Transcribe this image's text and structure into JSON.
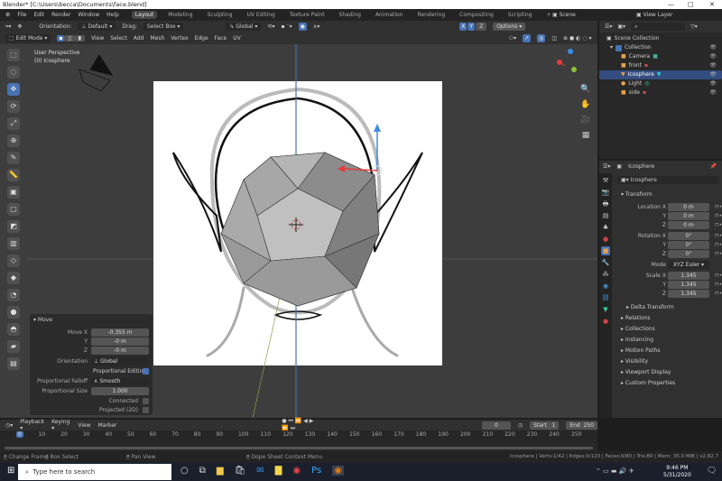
{
  "window": {
    "title": "Blender* [C:\\Users\\becca\\Documents\\face.blend]",
    "min": "—",
    "max": "□",
    "close": "✕"
  },
  "menu": [
    "File",
    "Edit",
    "Render",
    "Window",
    "Help"
  ],
  "workspaces": [
    "Layout",
    "Modeling",
    "Sculpting",
    "UV Editing",
    "Texture Paint",
    "Shading",
    "Animation",
    "Rendering",
    "Compositing",
    "Scripting",
    "+"
  ],
  "scene": "Scene",
  "view_layer": "View Layer",
  "header": {
    "orientation_label": "Orientation:",
    "orientation": "Default",
    "drag_label": "Drag:",
    "drag": "Select Box",
    "transform_orientation": "Global",
    "axes": [
      "X",
      "Y",
      "Z"
    ],
    "options": "Options"
  },
  "header2": {
    "mode": "Edit Mode",
    "menus": [
      "View",
      "Select",
      "Add",
      "Mesh",
      "Vertex",
      "Edge",
      "Face",
      "UV"
    ]
  },
  "viewport": {
    "perspective": "User Perspective",
    "object": "(0) Icosphere"
  },
  "outliner": {
    "root": "Scene Collection",
    "collection": "Collection",
    "items": [
      {
        "name": "Camera",
        "color": "#e8a050"
      },
      {
        "name": "front",
        "color": "#e8a050"
      },
      {
        "name": "Icosphere",
        "color": "#e8a050"
      },
      {
        "name": "Light",
        "color": "#e8a050"
      },
      {
        "name": "side",
        "color": "#e8a050"
      }
    ]
  },
  "properties": {
    "object": "Icosphere",
    "name_field": "Icosphere",
    "section": "Transform",
    "location": {
      "label": "Location X",
      "x": "0 m",
      "y": "0 m",
      "z": "0 m"
    },
    "rotation": {
      "label": "Rotation X",
      "x": "0°",
      "y": "0°",
      "z": "0°"
    },
    "mode_label": "Mode",
    "mode": "XYZ Euler",
    "scale": {
      "label": "Scale X",
      "x": "1.345",
      "y": "1.345",
      "z": "1.345"
    },
    "axis_y": "Y",
    "axis_z": "Z",
    "subpanels": [
      "Delta Transform",
      "Relations",
      "Collections",
      "Instancing",
      "Motion Paths",
      "Visibility",
      "Viewport Display",
      "Custom Properties"
    ]
  },
  "move_panel": {
    "title": "Move",
    "move_x_label": "Move X",
    "x": "-0.355 m",
    "y_label": "Y",
    "y": "-0 m",
    "z_label": "Z",
    "z": "-0 m",
    "orientation_label": "Orientation",
    "orientation": "Global",
    "prop_edit": "Proportional Editing",
    "falloff_label": "Proportional Falloff",
    "falloff": "Smooth",
    "size_label": "Proportional Size",
    "size": "1.000",
    "connected": "Connected",
    "projected": "Projected (2D)"
  },
  "timeline": {
    "menus": [
      "Playback",
      "Keying",
      "View",
      "Marker"
    ],
    "current_frame": "0",
    "start_label": "Start",
    "start": "1",
    "end_label": "End",
    "end": "250",
    "ticks": [
      "0",
      "10",
      "20",
      "30",
      "40",
      "50",
      "60",
      "70",
      "80",
      "90",
      "100",
      "110",
      "120",
      "130",
      "140",
      "150",
      "160",
      "170",
      "180",
      "190",
      "200",
      "210",
      "220",
      "230",
      "240",
      "250"
    ]
  },
  "status": {
    "left": [
      "Change Frame",
      "Box Select",
      "Pan View",
      "Dope Sheet Context Menu"
    ],
    "right": "Icosphere | Verts:1/42 | Edges:0/120 | Faces:0/80 | Tris:80 | Mem: 35.0 MiB | v2.82.7"
  },
  "taskbar": {
    "search": "Type here to search",
    "time": "9:46 PM",
    "date": "5/31/2020"
  },
  "colors": {
    "accent": "#4772b3",
    "viewport": "#3d3d3d",
    "selected_row": "#334d80"
  }
}
